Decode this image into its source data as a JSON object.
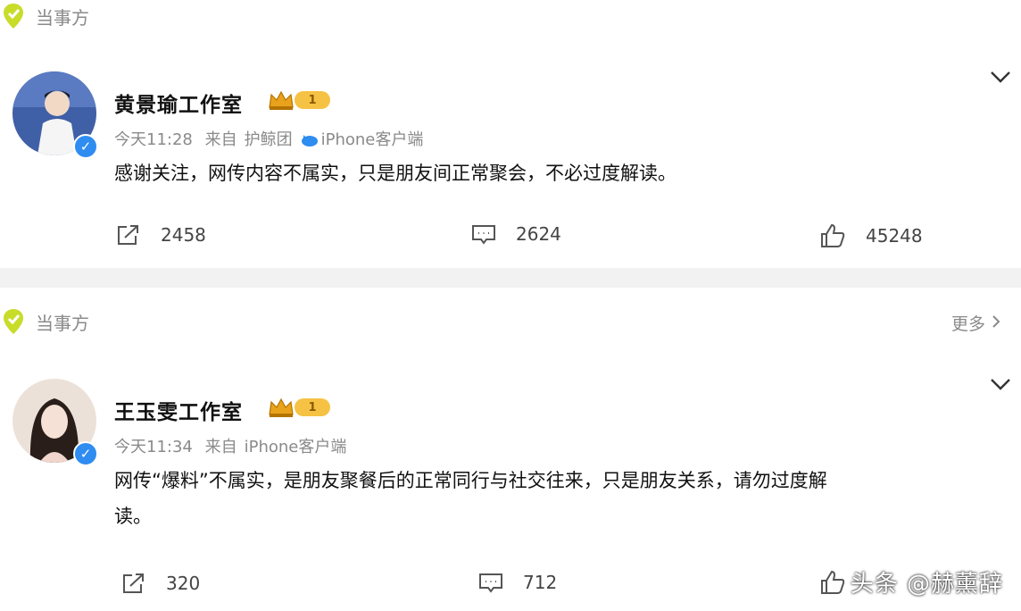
{
  "posts": [
    {
      "source_label": "当事方",
      "more_label": "",
      "name": "黄景瑜工作室",
      "level": "1",
      "time": "今天11:28",
      "from_label": "来自",
      "client_prefix": "护鲸团",
      "client": "iPhone客户端",
      "text": "感谢关注，网传内容不属实，只是朋友间正常聚会，不必过度解读。",
      "reposts": "2458",
      "comments": "2624",
      "likes": "45248"
    },
    {
      "source_label": "当事方",
      "more_label": "更多",
      "name": "王玉雯工作室",
      "level": "1",
      "time": "今天11:34",
      "from_label": "来自",
      "client_prefix": "",
      "client": "iPhone客户端",
      "text_line1": "网传“爆料”不属实，是朋友聚餐后的正常同行与社交往来，只是朋友关系，请勿过度解",
      "text_line2": "读。",
      "reposts": "320",
      "comments": "712",
      "likes": ""
    }
  ],
  "watermark": "头条 @赫薰辞",
  "colors": {
    "accent_blue": "#2f8cf0",
    "pin_green": "#c8dc2a",
    "level_gold": "#f6c244",
    "muted": "#8a8a8a"
  }
}
